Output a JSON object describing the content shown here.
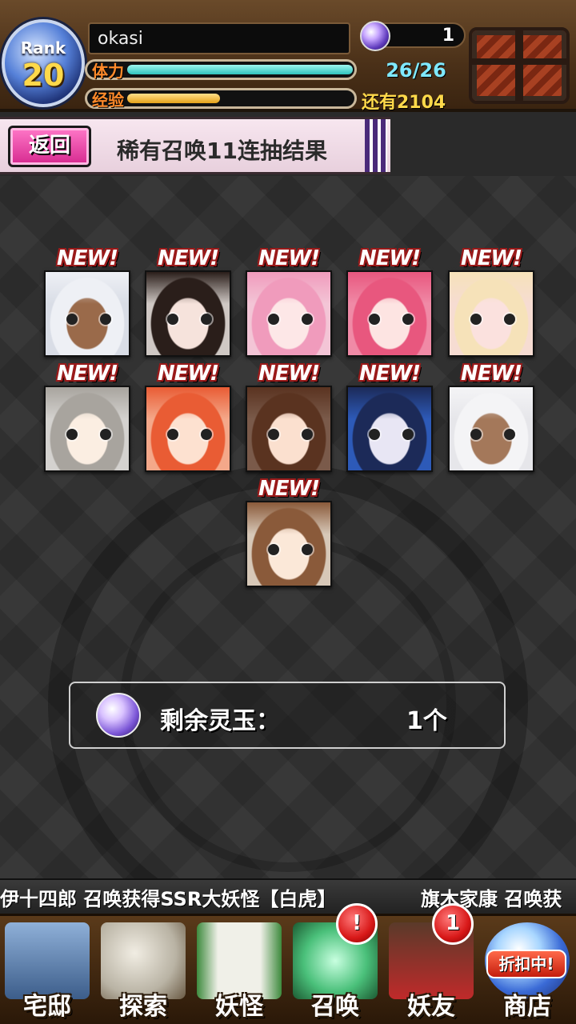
{
  "player": {
    "rank_label": "Rank",
    "rank_value": "20",
    "name": "okasi",
    "stamina_label": "体力",
    "stamina_text": "26/26",
    "stamina_fraction": 1.0,
    "exp_label": "经验",
    "exp_fraction": 0.4,
    "exp_remaining": "还有2104",
    "gem_count": "1"
  },
  "banner": {
    "back_label": "返回",
    "title": "稀有召唤11连抽结果"
  },
  "new_badge_text": "NEW!",
  "cards": [
    {
      "name": "card-1",
      "colors": {
        "bg": "#d9dde6",
        "hair": "#eef0f5",
        "skin": "#9a6a4a"
      }
    },
    {
      "name": "card-2",
      "colors": {
        "bg": "#cfc8c4",
        "hair": "#2a1e1a",
        "skin": "#f6e3dc"
      }
    },
    {
      "name": "card-3",
      "colors": {
        "bg": "#f3c5d6",
        "hair": "#f09bbc",
        "skin": "#fde7e7"
      }
    },
    {
      "name": "card-4",
      "colors": {
        "bg": "#f08aa6",
        "hair": "#e8577e",
        "skin": "#fde4e2"
      }
    },
    {
      "name": "card-5",
      "colors": {
        "bg": "#f6dcd2",
        "hair": "#f6e2b9",
        "skin": "#fbe1de"
      }
    },
    {
      "name": "card-6",
      "colors": {
        "bg": "#d4d2cf",
        "hair": "#a8a49e",
        "skin": "#fbeee2"
      }
    },
    {
      "name": "card-7",
      "colors": {
        "bg": "#f4a88a",
        "hair": "#e95c34",
        "skin": "#fde1d0"
      }
    },
    {
      "name": "card-8",
      "colors": {
        "bg": "#7a5a4a",
        "hair": "#5a3320",
        "skin": "#fbe0cf"
      }
    },
    {
      "name": "card-9",
      "colors": {
        "bg": "#2d5ab8",
        "hair": "#1c2a58",
        "skin": "#e8e6f4"
      }
    },
    {
      "name": "card-10",
      "colors": {
        "bg": "#e6e6ea",
        "hair": "#f4f4f6",
        "skin": "#a4785a"
      }
    },
    {
      "name": "card-11",
      "colors": {
        "bg": "#d7c8b8",
        "hair": "#8a5a3a",
        "skin": "#fbe8d8"
      }
    }
  ],
  "remaining": {
    "label": "剩余灵玉：",
    "value": "1个"
  },
  "ticker": {
    "message_1": "伊十四郎 召唤获得SSR大妖怪【白虎】",
    "message_2": "旗木家康 召唤获"
  },
  "nav": [
    {
      "name": "nav-home",
      "label": "宅邸",
      "icon": "house-icon",
      "badge": ""
    },
    {
      "name": "nav-explore",
      "label": "探索",
      "icon": "magnifier-map-icon",
      "badge": ""
    },
    {
      "name": "nav-yokai",
      "label": "妖怪",
      "icon": "scroll-icon",
      "badge": ""
    },
    {
      "name": "nav-summon",
      "label": "召唤",
      "icon": "pentagram-icon",
      "badge": "!"
    },
    {
      "name": "nav-friends",
      "label": "妖友",
      "icon": "catgirl-icon",
      "badge": "1"
    },
    {
      "name": "nav-shop",
      "label": "商店",
      "icon": "orb-icon",
      "badge": "",
      "sale": "折扣中!"
    }
  ],
  "colors": {
    "accent_pink": "#d6298f",
    "stamina": "#2fc4bd",
    "exp": "#e5a21a",
    "gold_text": "#ffd94a"
  }
}
